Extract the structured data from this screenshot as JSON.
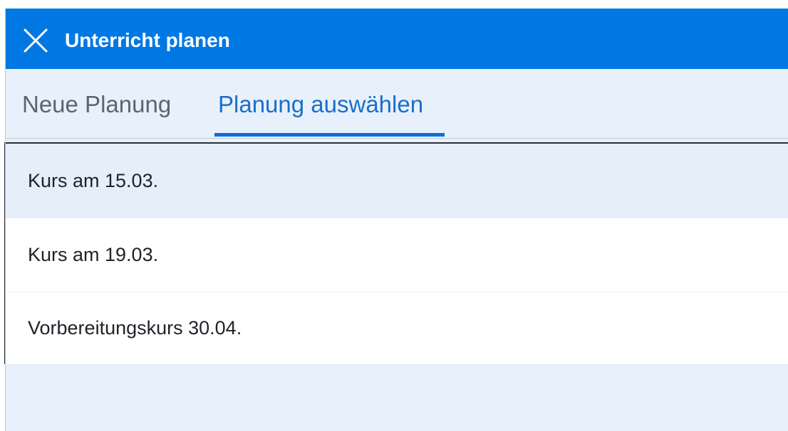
{
  "dialog": {
    "title": "Unterricht planen",
    "close_icon": "close-icon",
    "header_color": "#0078e3"
  },
  "tabs": [
    {
      "label": "Neue Planung",
      "selected": false
    },
    {
      "label": "Planung auswählen",
      "selected": true
    }
  ],
  "planning_list": {
    "items": [
      {
        "label": "Kurs am 15.03.",
        "highlighted": true
      },
      {
        "label": "Kurs am 19.03.",
        "highlighted": false
      },
      {
        "label": "Vorbereitungskurs 30.04.",
        "highlighted": false
      }
    ]
  },
  "colors": {
    "accent": "#0078e3",
    "selected_tab_text": "#1a6fc9",
    "panel_background": "#e8f0fb",
    "highlighted_row": "#e6eefa"
  }
}
